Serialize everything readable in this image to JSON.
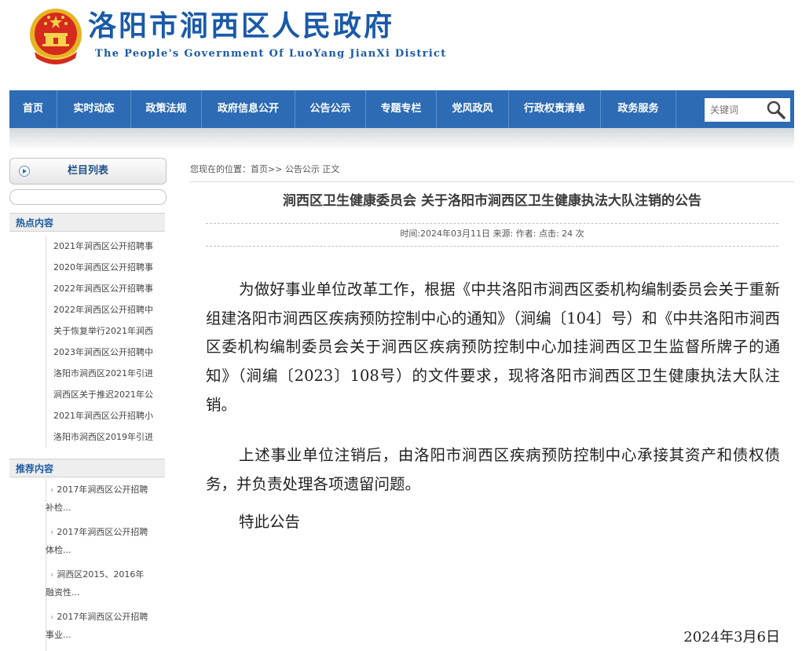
{
  "header": {
    "title": "洛阳市涧西区人民政府",
    "subtitle": "The People's Government Of LuoYang JianXi District"
  },
  "nav": {
    "items": [
      "首页",
      "实时动态",
      "政策法规",
      "政府信息公开",
      "公告公示",
      "专题专栏",
      "党风政风",
      "行政权责清单",
      "政务服务"
    ],
    "search_placeholder": "关键词"
  },
  "sidebar": {
    "column_list_label": "栏目列表",
    "hot_title": "热点内容",
    "hot_items": [
      "2021年涧西区公开招聘事",
      "2020年涧西区公开招聘事",
      "2022年涧西区公开招聘事",
      "2022年涧西区公开招聘中",
      "关于恢复举行2021年涧西",
      "2023年涧西区公开招聘中",
      "洛阳市涧西区2021年引进",
      "涧西区关于推迟2021年公",
      "2021年涧西区公开招聘小",
      "洛阳市涧西区2019年引进"
    ],
    "recommend_title": "推荐内容",
    "recommend_items": [
      {
        "line1": "2017年涧西区公开招聘",
        "line2": "补检..."
      },
      {
        "line1": "2017年涧西区公开招聘",
        "line2": "体检..."
      },
      {
        "line1": "涧西区2015、2016年",
        "line2": "融资性..."
      },
      {
        "line1": "2017年涧西区公开招聘",
        "line2": "事业..."
      }
    ]
  },
  "main": {
    "breadcrumb": {
      "prefix": "您现在的位置：",
      "home": "首页",
      "sep": ">>",
      "current": "公告公示 正文"
    },
    "article": {
      "title": "涧西区卫生健康委员会 关于洛阳市涧西区卫生健康执法大队注销的公告",
      "meta": "时间:2024年03月11日 来源: 作者: 点击: 24 次",
      "paragraphs": [
        "为做好事业单位改革工作，根据《中共洛阳市涧西区委机构编制委员会关于重新组建洛阳市涧西区疾病预防控制中心的通知》（涧编〔104〕号）和《中共洛阳市涧西区委机构编制委员会关于涧西区疾病预防控制中心加挂涧西区卫生监督所牌子的通知》（涧编〔2023〕108号）的文件要求，现将洛阳市涧西区卫生健康执法大队注销。",
        "上述事业单位注销后，由洛阳市涧西区疾病预防控制中心承接其资产和债权债务，并负责处理各项遗留问题。",
        "特此公告"
      ],
      "date": "2024年3月6日"
    }
  },
  "colors": {
    "brand_blue": "#1a5aa8",
    "nav_blue": "#2d6bb4",
    "emblem_red": "#d62a1e",
    "emblem_gold": "#e6b422"
  }
}
